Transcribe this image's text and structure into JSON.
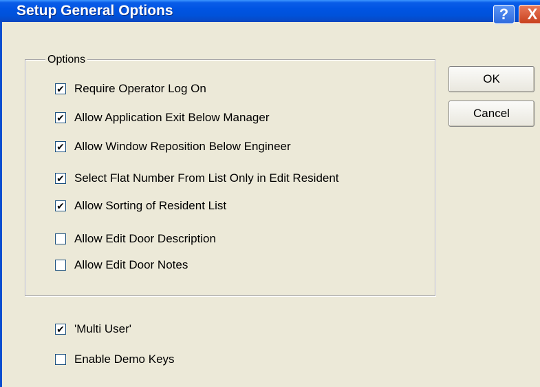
{
  "window": {
    "title": "Setup General Options",
    "help_label": "?",
    "close_label": "X"
  },
  "options_group": {
    "label": "Options",
    "items": [
      {
        "label": "Require Operator Log On",
        "checked": true
      },
      {
        "label": "Allow Application Exit Below Manager",
        "checked": true
      },
      {
        "label": "Allow Window Reposition Below Engineer",
        "checked": true
      },
      {
        "label": "Select Flat Number From List Only in Edit Resident",
        "checked": true
      },
      {
        "label": "Allow Sorting of Resident List",
        "checked": true
      },
      {
        "label": "Allow Edit Door Description",
        "checked": false
      },
      {
        "label": "Allow Edit Door Notes",
        "checked": false
      }
    ]
  },
  "extra_options": [
    {
      "label": "'Multi User'",
      "checked": true
    },
    {
      "label": "Enable Demo Keys",
      "checked": false
    }
  ],
  "buttons": {
    "ok_label": "OK",
    "cancel_label": "Cancel"
  }
}
